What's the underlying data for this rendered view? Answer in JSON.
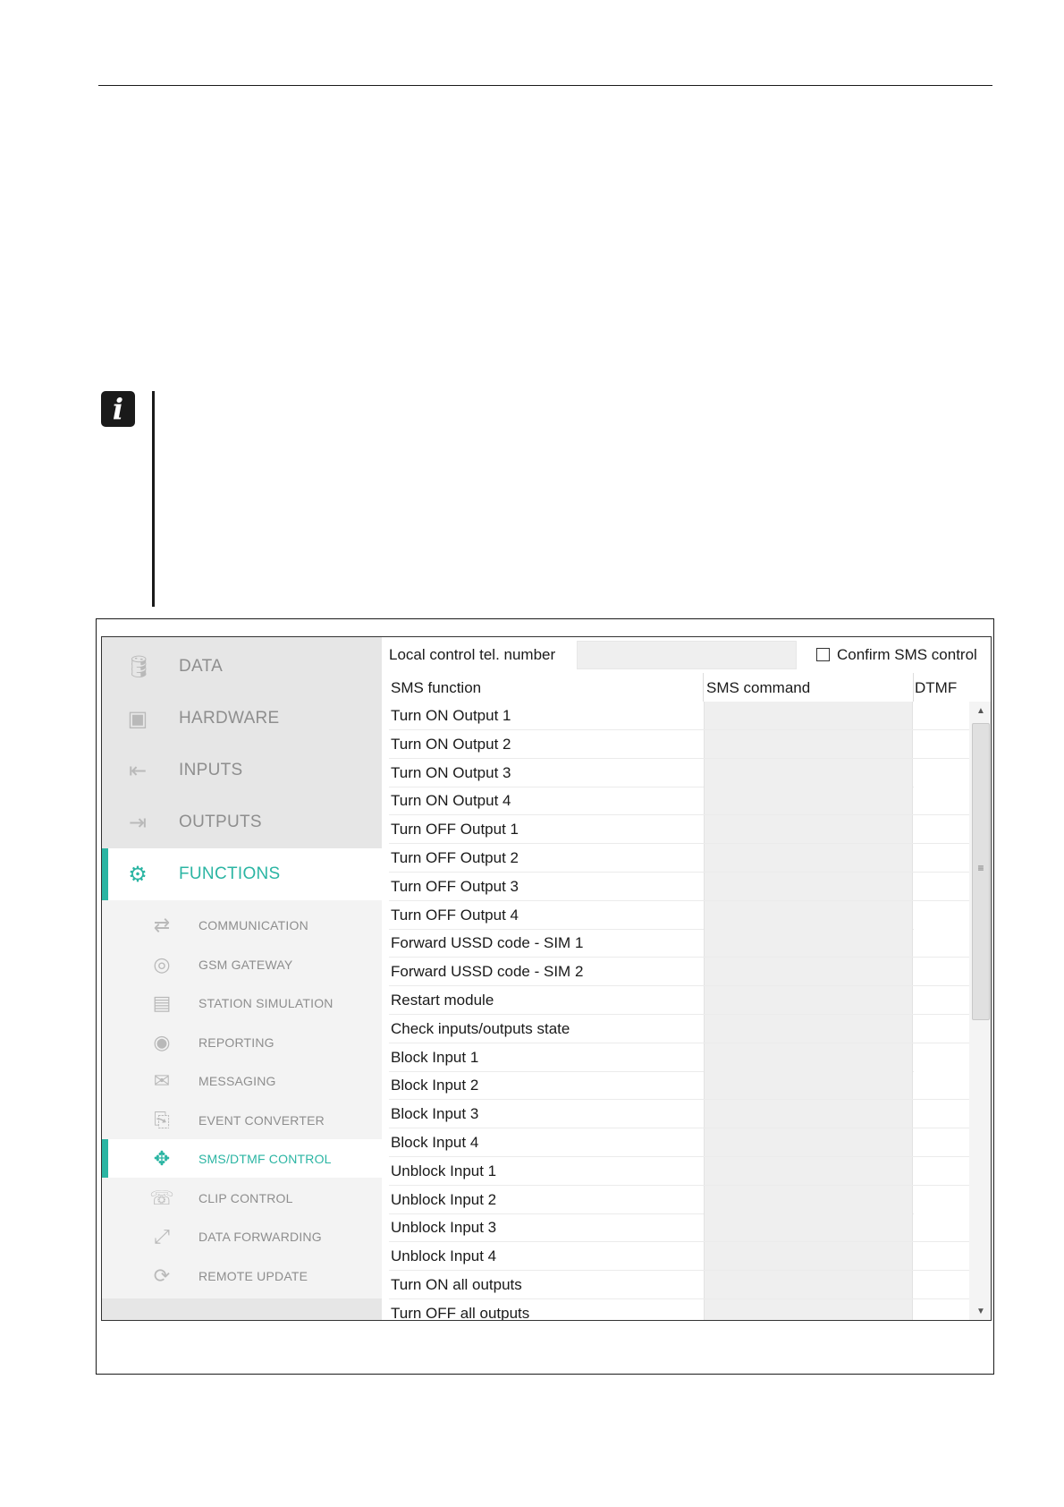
{
  "page": {
    "note_icon": "i"
  },
  "sidebar": {
    "main_items": [
      {
        "label": "DATA",
        "icon": "database-icon",
        "glyph": "🛢"
      },
      {
        "label": "HARDWARE",
        "icon": "chip-icon",
        "glyph": "▣"
      },
      {
        "label": "INPUTS",
        "icon": "input-icon",
        "glyph": "⇤"
      },
      {
        "label": "OUTPUTS",
        "icon": "output-icon",
        "glyph": "⇥"
      },
      {
        "label": "FUNCTIONS",
        "icon": "gear-icon",
        "glyph": "⚙",
        "active": true
      }
    ],
    "sub_items": [
      {
        "label": "COMMUNICATION",
        "icon": "communication-icon",
        "glyph": "⇄"
      },
      {
        "label": "GSM GATEWAY",
        "icon": "gsm-gateway-icon",
        "glyph": "◎"
      },
      {
        "label": "STATION SIMULATION",
        "icon": "station-icon",
        "glyph": "▤"
      },
      {
        "label": "REPORTING",
        "icon": "eye-icon",
        "glyph": "◉"
      },
      {
        "label": "MESSAGING",
        "icon": "messaging-icon",
        "glyph": "✉"
      },
      {
        "label": "EVENT CONVERTER",
        "icon": "event-converter-icon",
        "glyph": "⎘"
      },
      {
        "label": "SMS/DTMF CONTROL",
        "icon": "sms-dtmf-icon",
        "glyph": "✥",
        "active": true
      },
      {
        "label": "CLIP CONTROL",
        "icon": "clip-icon",
        "glyph": "☏"
      },
      {
        "label": "DATA FORWARDING",
        "icon": "data-forwarding-icon",
        "glyph": "⤢"
      },
      {
        "label": "REMOTE UPDATE",
        "icon": "remote-update-icon",
        "glyph": "⟳"
      }
    ]
  },
  "form": {
    "local_control_label": "Local control tel. number",
    "local_control_value": "",
    "confirm_label": "Confirm SMS control",
    "confirm_checked": false
  },
  "table": {
    "headers": [
      "SMS function",
      "SMS command",
      "DTMF"
    ],
    "rows": [
      "Turn ON Output 1",
      "Turn ON Output 2",
      "Turn ON Output 3",
      "Turn ON Output 4",
      "Turn OFF Output 1",
      "Turn OFF Output 2",
      "Turn OFF Output 3",
      "Turn OFF Output 4",
      "Forward USSD code - SIM 1",
      "Forward USSD code - SIM 2",
      "Restart module",
      "Check inputs/outputs state",
      "Block Input 1",
      "Block Input 2",
      "Block Input 3",
      "Block Input 4",
      "Unblock Input 1",
      "Unblock Input 2",
      "Unblock Input 3",
      "Unblock Input 4",
      "Turn ON all outputs",
      "Turn OFF all outputs"
    ]
  },
  "colors": {
    "accent": "#2bb5a3",
    "sidebar_bg": "#f3f3f3",
    "main_item_bg": "#e6e6e6",
    "field_bg": "#efefef"
  }
}
